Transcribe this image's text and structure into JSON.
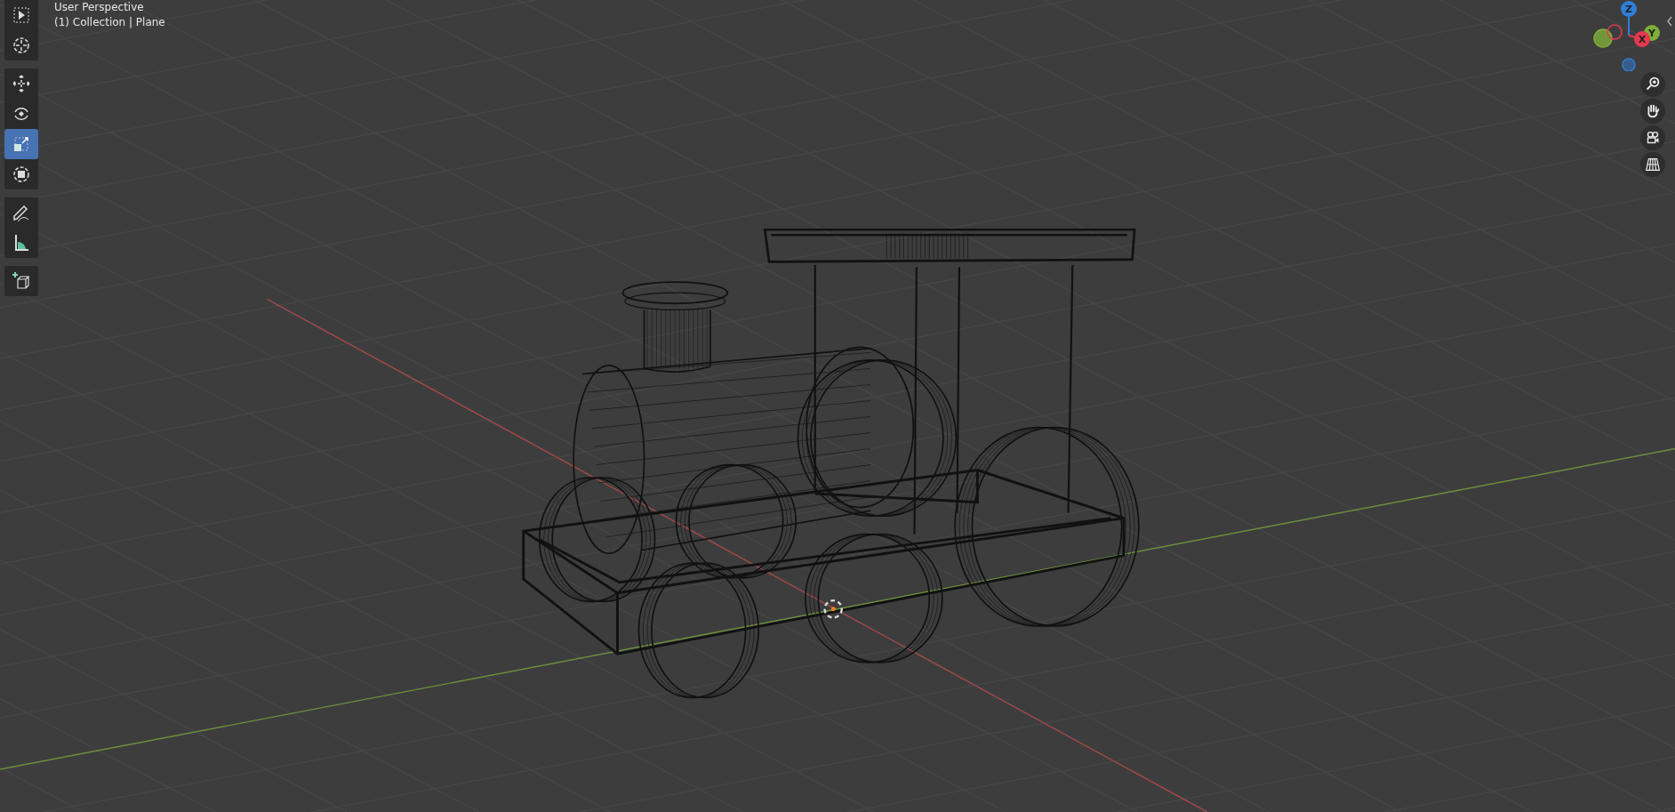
{
  "viewport": {
    "view_name": "User Perspective",
    "context": "(1) Collection | Plane"
  },
  "toolbar": {
    "groups": [
      [
        {
          "kind": "select",
          "selected": false
        },
        {
          "kind": "cursor",
          "selected": false
        }
      ],
      [
        {
          "kind": "move",
          "selected": false
        },
        {
          "kind": "rotate",
          "selected": false
        },
        {
          "kind": "scale",
          "selected": true
        },
        {
          "kind": "transform",
          "selected": false
        }
      ],
      [
        {
          "kind": "annotate",
          "selected": false
        },
        {
          "kind": "measure",
          "selected": false
        }
      ],
      [
        {
          "kind": "add_cube",
          "selected": false
        }
      ]
    ]
  },
  "gizmo": {
    "axes": [
      {
        "label": "Z",
        "color": "#2f7fd8"
      },
      {
        "label": "Y",
        "color": "#7fae3a"
      },
      {
        "label": "X",
        "color": "#e8384f"
      }
    ]
  },
  "navigation": [
    {
      "kind": "zoom"
    },
    {
      "kind": "pan"
    },
    {
      "kind": "camera"
    },
    {
      "kind": "perspective"
    }
  ]
}
